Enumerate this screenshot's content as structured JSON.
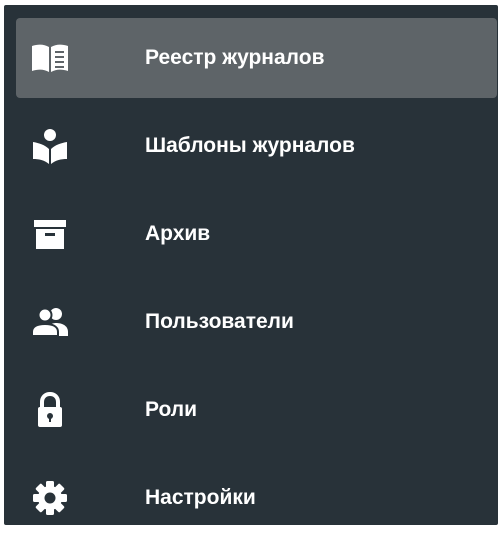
{
  "sidebar": {
    "active_index": 0,
    "colors": {
      "background": "#283239",
      "active_background": "#5e6468",
      "text": "#ffffff",
      "icon": "#ffffff"
    },
    "items": [
      {
        "label": "Реестр журналов",
        "icon": "open-book-icon"
      },
      {
        "label": "Шаблоны журналов",
        "icon": "reader-book-icon"
      },
      {
        "label": "Архив",
        "icon": "archive-box-icon"
      },
      {
        "label": "Пользователи",
        "icon": "users-icon"
      },
      {
        "label": "Роли",
        "icon": "lock-icon"
      },
      {
        "label": "Настройки",
        "icon": "gear-icon"
      }
    ]
  }
}
